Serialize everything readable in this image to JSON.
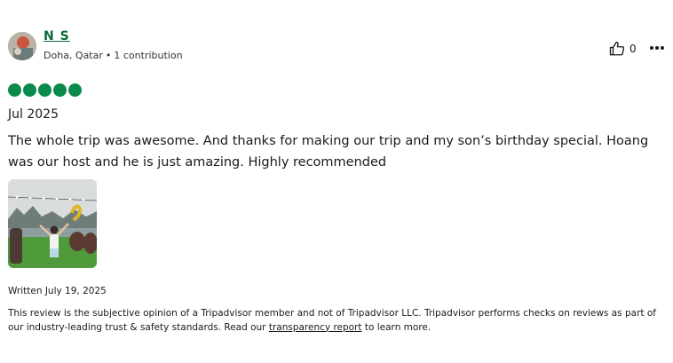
{
  "reviewer": {
    "name": "N S",
    "location": "Doha, Qatar",
    "contributions": "1 contribution"
  },
  "actions": {
    "helpful_count": "0",
    "helpful_icon": "thumbs-up-icon",
    "more_icon": "more-icon"
  },
  "rating": {
    "value": 5,
    "max": 5
  },
  "visit_date": "Jul 2025",
  "review_text": "The whole trip was awesome. And thanks for making our trip and my son’s birthday special. Hoang was our host and he is just amazing. Highly recommended",
  "photo": {
    "count": 1
  },
  "written_date": "Written July 19, 2025",
  "disclaimer": {
    "text_before": "This review is the subjective opinion of a Tripadvisor member and not of Tripadvisor LLC. Tripadvisor performs checks on reviews as part of our industry-leading trust & safety standards. Read our ",
    "link_text": "transparency report",
    "text_after": " to learn more."
  },
  "colors": {
    "brand_green": "#0a8a4a",
    "text": "#1a1a1a"
  }
}
